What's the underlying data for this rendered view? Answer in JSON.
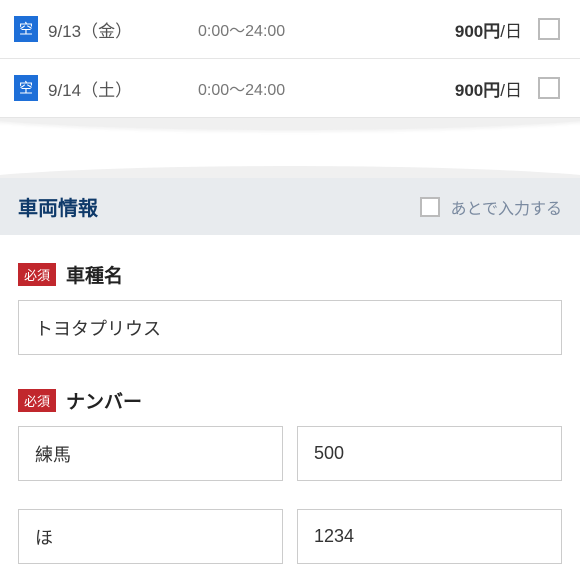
{
  "dates": [
    {
      "badge": "空",
      "date": "9/13（金）",
      "time": "0:00～24:00",
      "price": "900円",
      "per": "/日"
    },
    {
      "badge": "空",
      "date": "9/14（土）",
      "time": "0:00～24:00",
      "price": "900円",
      "per": "/日"
    }
  ],
  "section": {
    "title": "車両情報",
    "later_label": "あとで入力する"
  },
  "fields": {
    "required_badge": "必須",
    "car_model": {
      "label": "車種名",
      "value": "トヨタプリウス"
    },
    "plate": {
      "label": "ナンバー",
      "region": "練馬",
      "class": "500",
      "kana": "ほ",
      "number": "1234"
    }
  }
}
